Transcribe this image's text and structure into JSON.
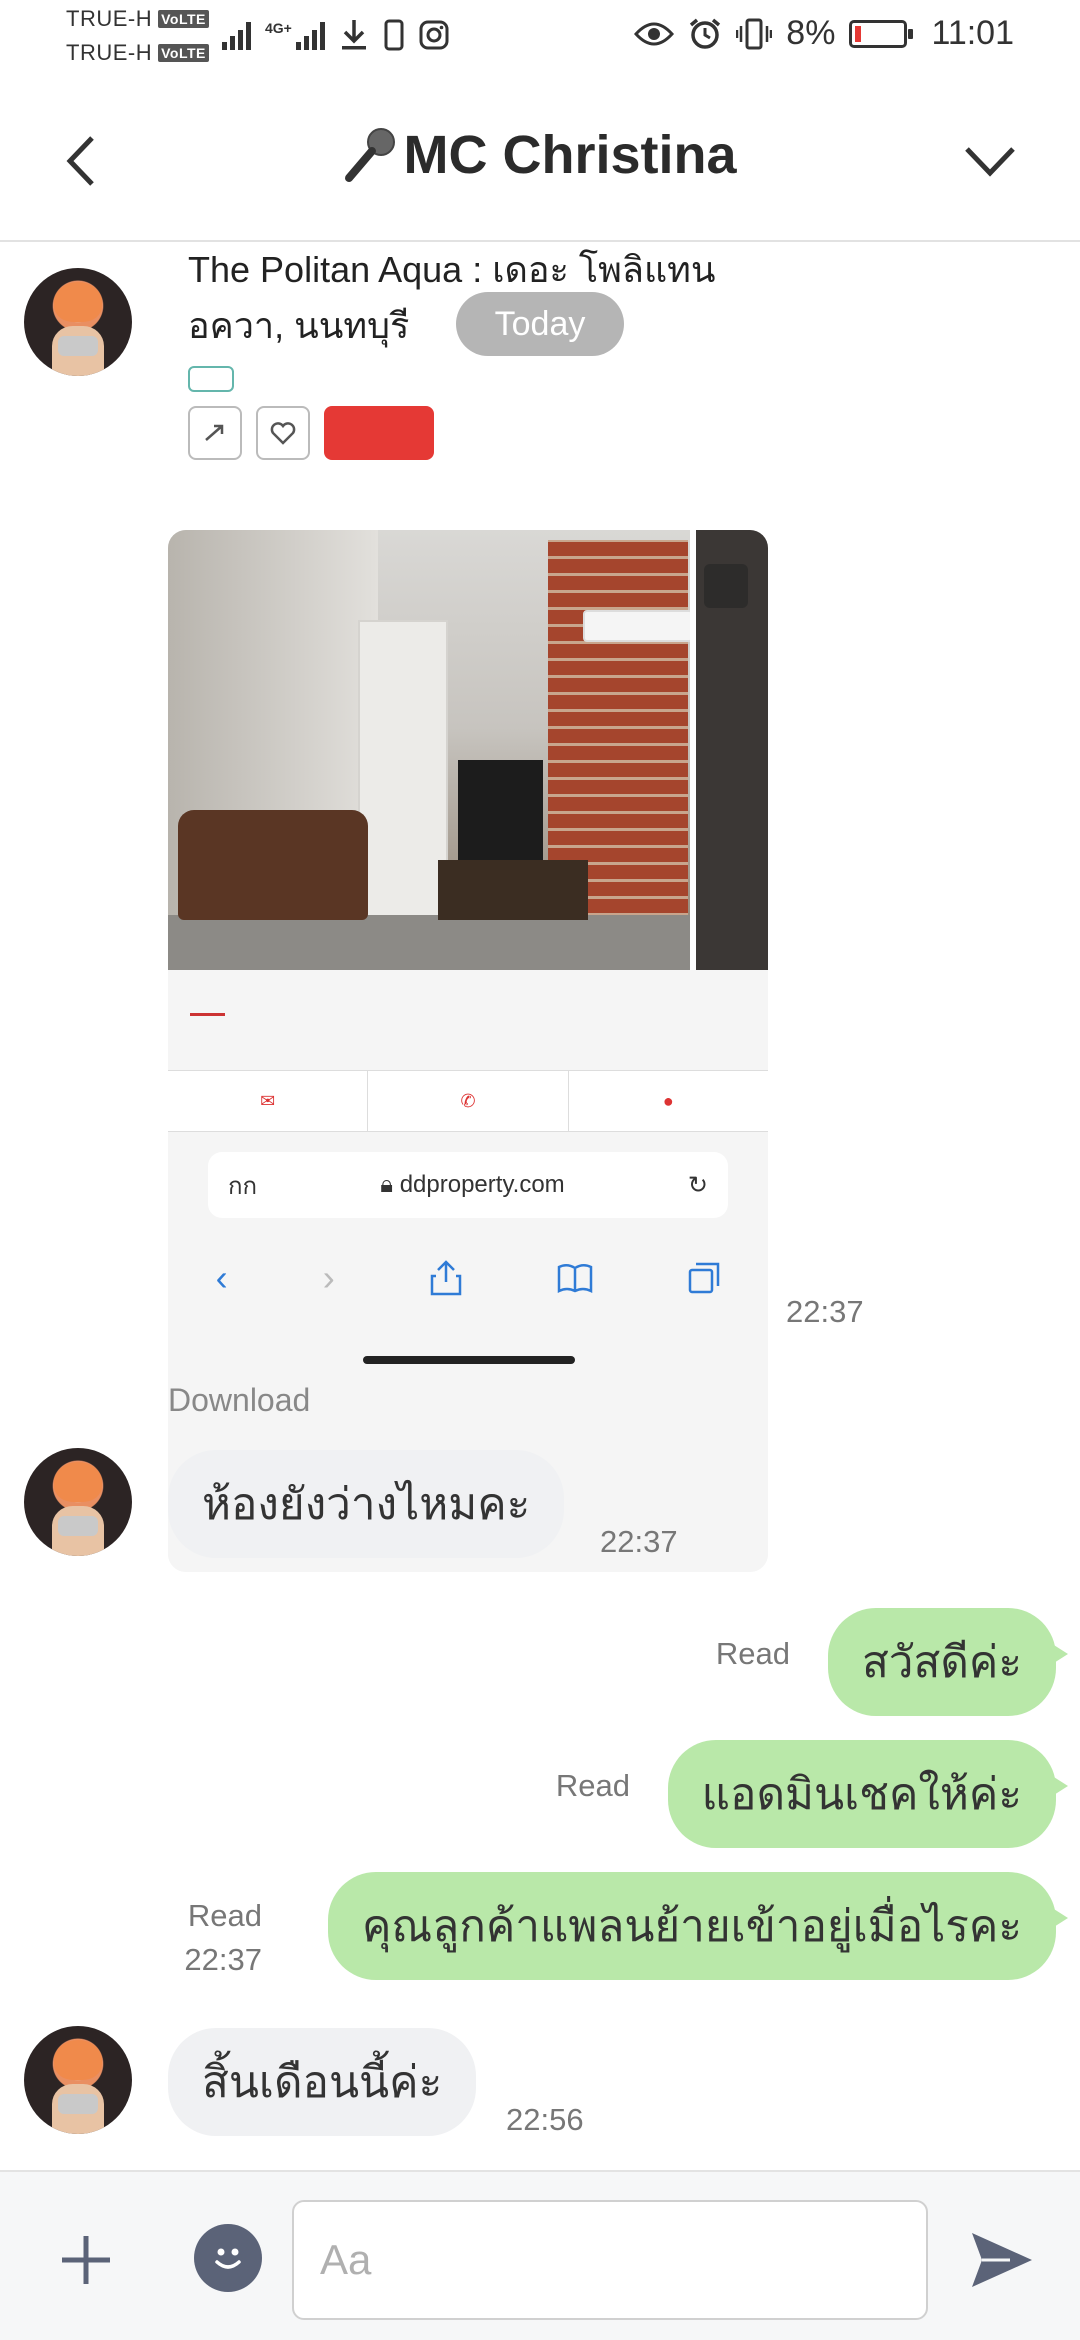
{
  "status_bar": {
    "carrier_1": "TRUE-H",
    "carrier_2": "TRUE-H",
    "volte": "VoLTE",
    "network": "4G+",
    "battery_percent": "8%",
    "time": "11:01"
  },
  "header": {
    "title": "MC Christina",
    "title_icon": "microphone-emoji",
    "back_icon": "chevron-left-icon",
    "menu_icon": "chevron-down-icon"
  },
  "chat": {
    "date_pill": "Today",
    "shared_listing": {
      "title_line_1": "The Politan Aqua : เดอะ โพลิแทน",
      "title_line_2": "อควา, นนทบุรี",
      "url": "ddproperty.com",
      "url_prefix": "กก",
      "time": "22:37",
      "download_label": "Download"
    },
    "messages": [
      {
        "direction": "in",
        "text": "ห้องยังว่างไหมคะ",
        "time": "22:37"
      },
      {
        "direction": "out",
        "text": "สวัสดีค่ะ",
        "status": "Read"
      },
      {
        "direction": "out",
        "text": "แอดมินเชคให้ค่ะ",
        "status": "Read"
      },
      {
        "direction": "out",
        "text": "คุณลูกค้าแพลนย้ายเข้าอยู่เมื่อไรคะ",
        "status": "Read",
        "time": "22:37"
      },
      {
        "direction": "in",
        "text": "สิ้นเดือนนี้ค่ะ",
        "time": "22:56"
      }
    ]
  },
  "input_bar": {
    "placeholder": "Aa",
    "value": ""
  },
  "colors": {
    "outgoing_bubble": "#b9e8a9",
    "incoming_bubble": "#f0f1f3",
    "date_pill": "#b5b5b5",
    "icon_dark": "#5b6378"
  }
}
